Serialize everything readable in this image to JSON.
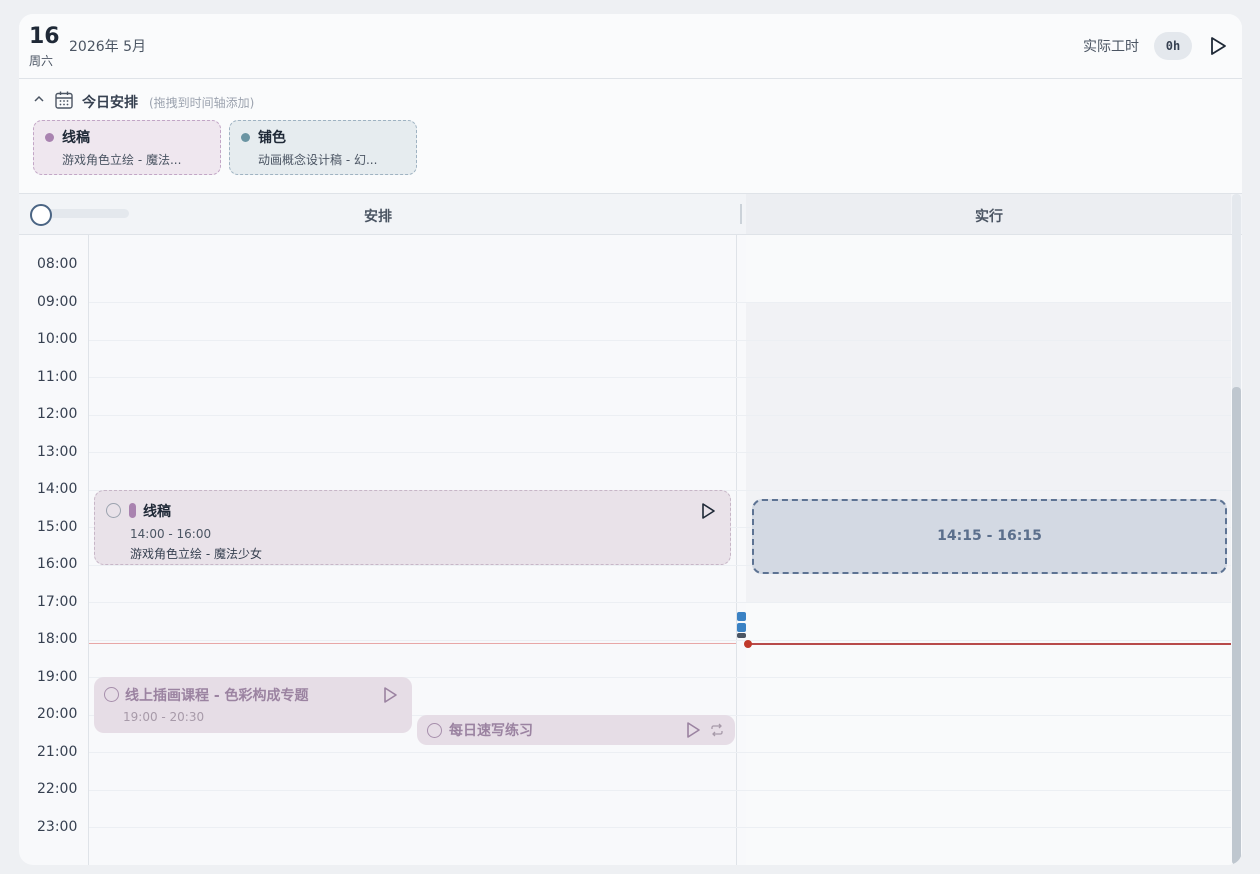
{
  "header": {
    "day": "16",
    "weekday": "周六",
    "year_month": "2026年 5月",
    "actual_hours_label": "实际工时",
    "actual_hours_value": "0h"
  },
  "today": {
    "title": "今日安排",
    "hint": "(拖拽到时间轴添加)",
    "tasks": [
      {
        "name": "线稿",
        "sub": "游戏角色立绘 - 魔法...",
        "color": "#a983b0"
      },
      {
        "name": "铺色",
        "sub": "动画概念设计稿 - 幻...",
        "color": "#6b95a3"
      }
    ]
  },
  "columns": {
    "schedule": "安排",
    "execution": "实行"
  },
  "zoom_level": 0.0,
  "timeline": {
    "hours": [
      "08:00",
      "09:00",
      "10:00",
      "11:00",
      "12:00",
      "13:00",
      "14:00",
      "15:00",
      "16:00",
      "17:00",
      "18:00",
      "19:00",
      "20:00",
      "21:00",
      "22:00",
      "23:00"
    ]
  },
  "schedule_blocks": [
    {
      "title": "线稿",
      "time": "14:00 - 16:00",
      "sub": "游戏角色立绘 - 魔法少女",
      "color": "#a983b0"
    },
    {
      "title": "线上插画课程 - 色彩构成专题",
      "time": "19:00 - 20:30"
    },
    {
      "title": "每日速写练习"
    }
  ],
  "actual_blocks": [
    {
      "time": "14:15 - 16:15"
    }
  ],
  "colors": {
    "accent": "#4b6584",
    "now_line": "#b84a4a",
    "purple": "#a983b0",
    "muted_purple": "#9b83a1"
  }
}
